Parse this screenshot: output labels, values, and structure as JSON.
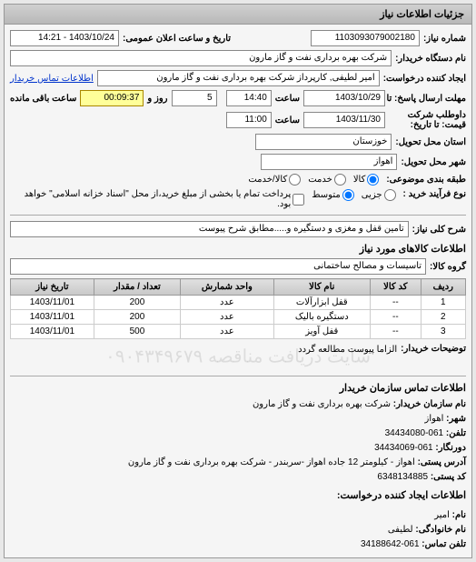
{
  "panel_title": "جزئیات اطلاعات نیاز",
  "form": {
    "req_no_label": "شماره نیاز:",
    "req_no": "1103093079002180",
    "announce_label": "تاریخ و ساعت اعلان عمومی:",
    "announce_value": "1403/10/24 - 14:21",
    "org_name_label": "نام دستگاه خریدار:",
    "org_name": "شرکت بهره برداری نفت و گاز مارون",
    "requester_label": "ایجاد کننده درخواست:",
    "requester": "امیر لطیفی, کارپرداز شرکت بهره برداری نفت و گاز مارون",
    "contact_link": "اطلاعات تماس خریدار",
    "deadline_label": "مهلت ارسال پاسخ: تا",
    "deadline_date": "1403/10/29",
    "deadline_time_label": "ساعت",
    "deadline_time": "14:40",
    "days_label": "روز و",
    "days_value": "5",
    "remain_label": "ساعت باقی مانده",
    "remain_value": "00:09:37",
    "valid_label": "داوطلب شرکت\nقیمت: تا تاریخ:",
    "valid_date": "1403/11/30",
    "valid_time_label": "ساعت",
    "valid_time": "11:00",
    "province_label": "استان محل تحویل:",
    "province": "خوزستان",
    "city_label": "شهر محل تحویل:",
    "city": "اهواز",
    "class_label": "طبقه بندی موضوعی:",
    "class_goods": "کالا",
    "class_service": "خدمت",
    "class_both": "کالا/خدمت",
    "process_label": "نوع فرآیند خرید :",
    "process_partial": "جزیی",
    "process_medium": "متوسط",
    "process_note": "پرداخت تمام یا بخشی از مبلغ خرید،از محل \"اسناد خزانه اسلامی\" خواهد بود.",
    "main_desc_label": "شرح کلی نیاز:",
    "main_desc": "تامين قفل و مغزی و دستگیره و.....مطابق شرح پیوست",
    "goods_section": "اطلاعات کالاهای مورد نیاز",
    "group_label": "گروه کالا:",
    "group_value": "تاسیسات و مصالح ساختمانی",
    "buyer_desc_label": "توضیحات خریدار:",
    "buyer_desc": "الزاما پیوست مطالعه گردد",
    "contact_section": "اطلاعات تماس سازمان خریدار",
    "c_org_label": "نام سازمان خریدار:",
    "c_org": "شرکت بهره برداری نفت و گاز مارون",
    "c_city_label": "شهر:",
    "c_city": "اهواز",
    "c_tel_label": "تلفن:",
    "c_tel": "061-34434080",
    "c_fax_label": "دورنگار:",
    "c_fax": "061-34434069",
    "c_addr_label": "آدرس پستی:",
    "c_addr": "اهواز - کیلومتر 12 جاده اهواز -سربندر - شرکت بهره برداری نفت و گاز مارون",
    "c_post_label": "کد پستی:",
    "c_post": "6348134885",
    "creator_section": "اطلاعات ایجاد کننده درخواست:",
    "c_name_label": "نام:",
    "c_name": "امیر",
    "c_lname_label": "نام خانوادگی:",
    "c_lname": "لطیفی",
    "c_phone_label": "تلفن تماس:",
    "c_phone": "061-34188642"
  },
  "table": {
    "headers": {
      "row": "ردیف",
      "code": "کد کالا",
      "name": "نام کالا",
      "unit": "واحد شمارش",
      "qty": "تعداد / مقدار",
      "date": "تاریخ نیاز"
    },
    "rows": [
      {
        "n": "1",
        "code": "--",
        "name": "قفل ابزارآلات",
        "unit": "عدد",
        "qty": "200",
        "date": "1403/11/01"
      },
      {
        "n": "2",
        "code": "--",
        "name": "دستگیره بالیک",
        "unit": "عدد",
        "qty": "200",
        "date": "1403/11/01"
      },
      {
        "n": "3",
        "code": "--",
        "name": "قفل آویز",
        "unit": "عدد",
        "qty": "500",
        "date": "1403/11/01"
      }
    ]
  },
  "watermark": "سایت دریافت مناقصه ۰۹۰۴۳۴۹۶۷۹"
}
